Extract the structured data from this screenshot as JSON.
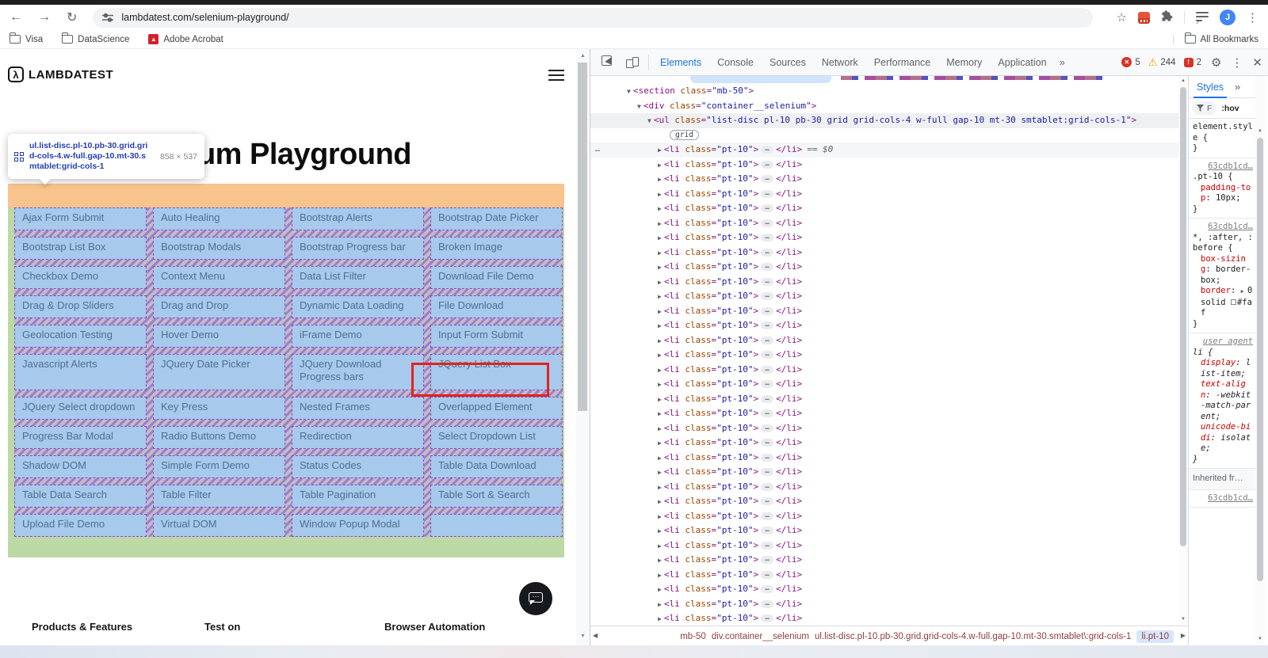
{
  "browser": {
    "url": "lambdatest.com/selenium-playground/",
    "profile_initial": "J",
    "bookmarks": [
      "Visa",
      "DataScience",
      "Adobe Acrobat"
    ],
    "all_bookmarks": "All Bookmarks"
  },
  "page": {
    "logo": "LAMBDATEST",
    "heading": "Selenium Playground",
    "tooltip": {
      "line1": "ul.list-disc.pl-10.pb-30.grid.gri",
      "line2": "d-cols-4.w-full.gap-10.mt-30.s",
      "line3": "mtablet:grid-cols-1",
      "dimensions": "858 × 537"
    },
    "links": [
      "Ajax Form Submit",
      "Auto Healing",
      "Bootstrap Alerts",
      "Bootstrap Date Picker",
      "Bootstrap List Box",
      "Bootstrap Modals",
      "Bootstrap Progress bar",
      "Broken Image",
      "Checkbox Demo",
      "Context Menu",
      "Data List Filter",
      "Download File Demo",
      "Drag & Drop Sliders",
      "Drag and Drop",
      "Dynamic Data Loading",
      "File Download",
      "Geolocation Testing",
      "Hover Demo",
      "iFrame Demo",
      "Input Form Submit",
      "Javascript Alerts",
      "JQuery Date Picker",
      "JQuery Download Progress bars",
      "JQuery List Box",
      "JQuery Select dropdown",
      "Key Press",
      "Nested Frames",
      "Overlapped Element",
      "Progress Bar Modal",
      "Radio Buttons Demo",
      "Redirection",
      "Select Dropdown List",
      "Shadow DOM",
      "Simple Form Demo",
      "Status Codes",
      "Table Data Download",
      "Table Data Search",
      "Table Filter",
      "Table Pagination",
      "Table Sort & Search",
      "Upload File Demo",
      "Virtual DOM",
      "Window Popup Modal"
    ],
    "highlighted_link": "Input Form Submit",
    "footer": [
      "Products & Features",
      "Test on",
      "Browser Automation"
    ]
  },
  "devtools": {
    "tabs": [
      "Elements",
      "Console",
      "Sources",
      "Network",
      "Performance",
      "Memory",
      "Application"
    ],
    "active_tab": "Elements",
    "more_tabs": "»",
    "badges": {
      "errors": "5",
      "warnings": "244",
      "issues": "2"
    },
    "tree": {
      "nodes": [
        {
          "tag": "section",
          "cls": "mb-50"
        },
        {
          "tag": "div",
          "cls": "container__selenium"
        },
        {
          "tag": "ul",
          "cls": "list-disc pl-10 pb-30 grid grid-cols-4 w-full gap-10 mt-30 smtablet:grid-cols-1"
        }
      ],
      "grid_badge": "grid",
      "li_tag": "li",
      "li_cls": "pt-10",
      "li_count": 34,
      "selected_suffix": "== $0"
    },
    "breadcrumbs": [
      "mb-50",
      "div.container__selenium",
      "ul.list-disc.pl-10.pb-30.grid.grid-cols-4.w-full.gap-10.mt-30.smtablet\\:grid-cols-1",
      "li.pt-10"
    ],
    "styles": {
      "tab": "Styles",
      "more": "»",
      "filter": "F",
      "hov": ":hov",
      "sections": [
        {
          "link": "",
          "selector": "element.style",
          "italic": false,
          "props": []
        },
        {
          "link": "63cdb1cd…",
          "selector": ".pt-10",
          "italic": false,
          "props": [
            {
              "name": "padding-top",
              "value": "10px;"
            }
          ]
        },
        {
          "link": "63cdb1cd…",
          "selector": "*, :after, :before",
          "italic": false,
          "props": [
            {
              "name": "box-sizing",
              "value": "border-box;"
            },
            {
              "name": "border",
              "value": "0 solid #faf",
              "expand": true,
              "swatch": true
            }
          ]
        },
        {
          "link": "user agent",
          "selector": "li",
          "italic": true,
          "props": [
            {
              "name": "display",
              "value": "list-item;"
            },
            {
              "name": "text-align",
              "value": "-webkit-match-parent;"
            },
            {
              "name": "unicode-bidi",
              "value": "isolate;"
            }
          ]
        }
      ],
      "inherited": "Inherited fr…",
      "inherited_link": "63cdb1cd…"
    }
  }
}
